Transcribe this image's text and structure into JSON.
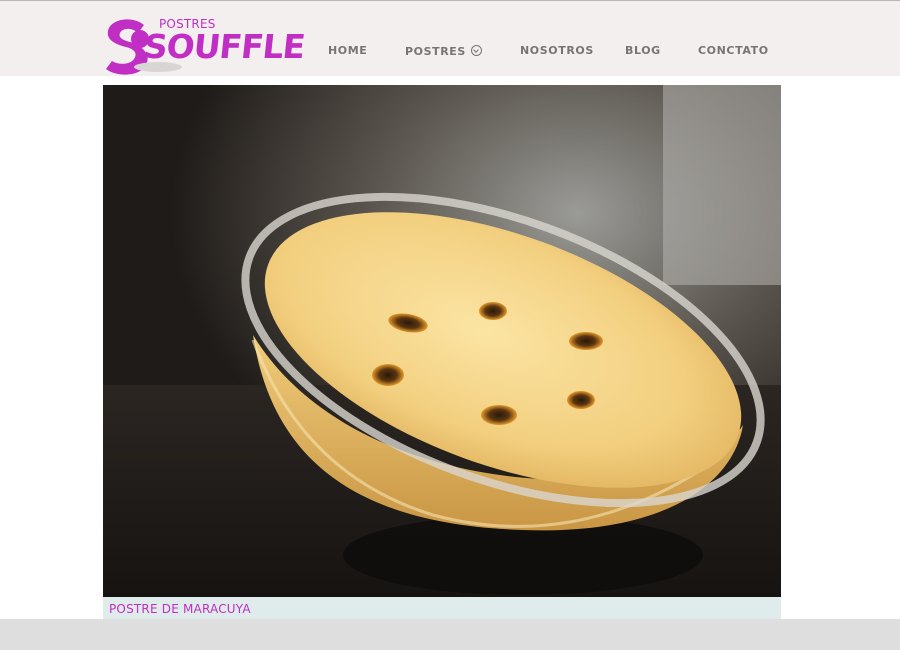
{
  "brand": {
    "small": "POSTRES",
    "big": "SOUFFLE",
    "color": "#c02ec3"
  },
  "nav": {
    "items": [
      {
        "label": "HOME"
      },
      {
        "label": "POSTRES"
      },
      {
        "label": "NOSOTROS"
      },
      {
        "label": "BLOG"
      },
      {
        "label": "CONCTATO"
      }
    ]
  },
  "gallery": {
    "caption": "POSTRE DE MARACUYA"
  }
}
